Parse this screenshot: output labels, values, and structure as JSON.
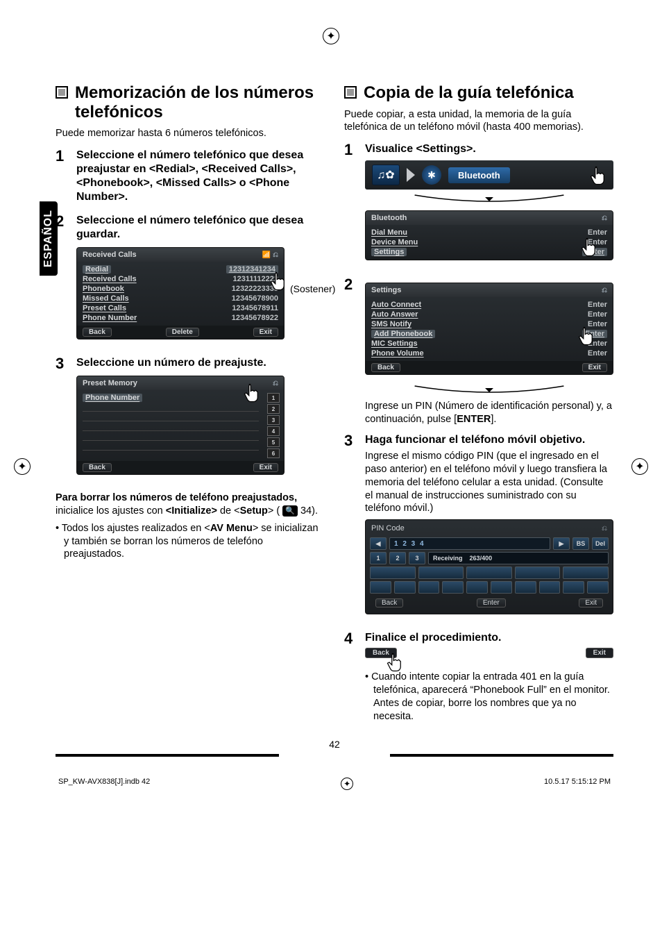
{
  "meta": {
    "language_tab": "ESPAÑOL",
    "page_number": "42",
    "footer_left": "SP_KW-AVX838[J].indb   42",
    "footer_right": "10.5.17   5:15:12 PM"
  },
  "left": {
    "heading": "Memorización de los números telefónicos",
    "intro": "Puede memorizar hasta 6 números telefónicos.",
    "steps": {
      "1": {
        "title": "Seleccione el número telefónico que desea preajustar en <Redial>, <Received Calls>, <Phonebook>, <Missed Calls> o <Phone Number>."
      },
      "2": {
        "title": "Seleccione el número telefónico que desea guardar.",
        "panel": {
          "header": "Received Calls",
          "rows": [
            {
              "left": "Redial",
              "right": "12312341234"
            },
            {
              "left": "Received Calls",
              "right": "12311112222"
            },
            {
              "left": "Phonebook",
              "right": "12322223333"
            },
            {
              "left": "Missed Calls",
              "right": "12345678900"
            },
            {
              "left": "Preset Calls",
              "right": "12345678911"
            },
            {
              "left": "Phone Number",
              "right": "12345678922"
            }
          ],
          "footer": {
            "back": "Back",
            "middle": "Delete",
            "exit": "Exit"
          },
          "hold": "(Sostener)"
        }
      },
      "3": {
        "title": "Seleccione un número de preajuste.",
        "panel": {
          "header": "Preset Memory",
          "phone_number_label": "Phone Number",
          "slots": [
            "1",
            "2",
            "3",
            "4",
            "5",
            "6"
          ],
          "footer": {
            "back": "Back",
            "exit": "Exit"
          }
        }
      }
    },
    "postscript": {
      "heading": "Para borrar los números de teléfono preajustados,",
      "body_pre": " inicialice los ajustes con ",
      "initialize": "<Initialize>",
      "of": " de <",
      "setup": "Setup",
      "page_ref_icon": "☸ 34",
      "close": ").",
      "bullet": "Todos los ajustes realizados en <AV Menu> se inicializan y también se borran los números de telefóno preajustados."
    }
  },
  "right": {
    "heading": "Copia de la guía telefónica",
    "intro": "Puede copiar, a esta unidad, la memoria de la guía telefónica de un teléfono móvil (hasta 400 memorias).",
    "steps": {
      "1": {
        "title": "Visualice <Settings>.",
        "strip": {
          "bluetooth_label": "Bluetooth"
        },
        "panel1": {
          "header": "Bluetooth",
          "rows": [
            {
              "left": "Dial Menu",
              "right": "Enter"
            },
            {
              "left": "Device Menu",
              "right": "Enter"
            },
            {
              "left": "Settings",
              "right": "Enter"
            }
          ]
        }
      },
      "2": {
        "panel": {
          "header": "Settings",
          "rows": [
            {
              "left": "Auto Connect",
              "right": "Enter"
            },
            {
              "left": "Auto Answer",
              "right": "Enter"
            },
            {
              "left": "SMS Notify",
              "right": "Enter"
            },
            {
              "left": "Add Phonebook",
              "right": "Enter"
            },
            {
              "left": "MIC Settings",
              "right": "Enter"
            },
            {
              "left": "Phone Volume",
              "right": "Enter"
            }
          ],
          "footer": {
            "back": "Back",
            "exit": "Exit"
          }
        },
        "after_text_1": "Ingrese un PIN (Número de identificación personal) y, a continuación, pulse [",
        "after_text_enter": "ENTER",
        "after_text_2": "]."
      },
      "3": {
        "title": "Haga funcionar el teléfono móvil objetivo.",
        "body": "Ingrese el mismo código PIN (que el ingresado en el paso anterior) en el teléfono móvil y luego transfiera la memoria del teléfono celular a esta unidad. (Consulte el manual de instrucciones suministrado con su teléfono móvil.)",
        "pin_panel": {
          "header": "PIN Code",
          "value": "1 2 3 4",
          "keys_nav": [
            "◀",
            "▶",
            "BS",
            "Del"
          ],
          "receiving": "Receiving",
          "progress": "263/400",
          "footer": {
            "back": "Back",
            "enter": "Enter",
            "exit": "Exit"
          }
        }
      },
      "4": {
        "title": "Finalice el procedimiento.",
        "buttons": {
          "back": "Back",
          "exit": "Exit"
        },
        "bullet": "Cuando intente copiar la entrada 401 en la guía telefónica, aparecerá “Phonebook Full” en el monitor. Antes de copiar, borre los nombres que ya no necesita."
      }
    }
  }
}
